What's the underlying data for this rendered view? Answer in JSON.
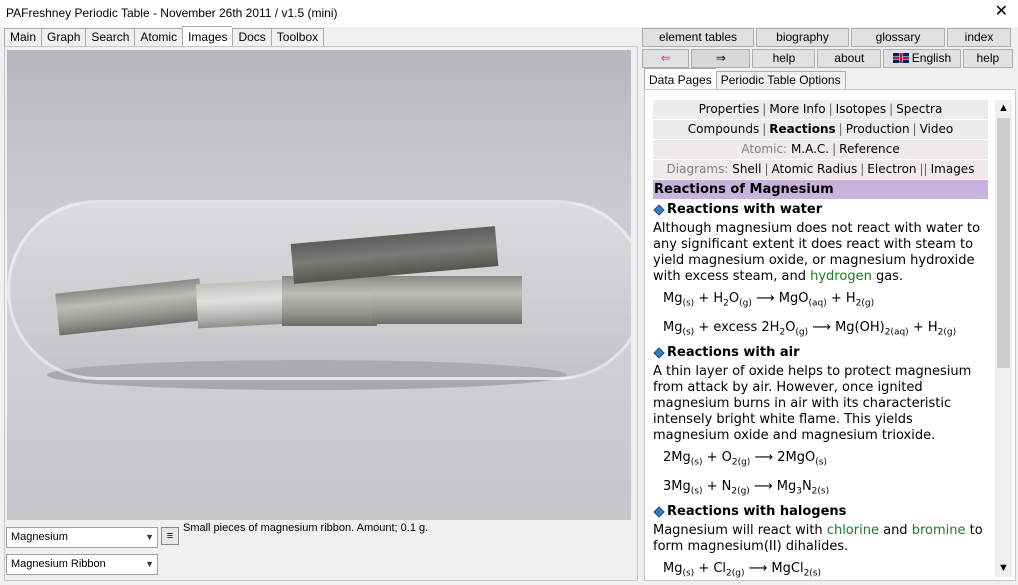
{
  "window": {
    "title": "PAFreshney Periodic Table - November 26th 2011 / v1.5 (mini)",
    "close": "✕"
  },
  "left_tabs": [
    {
      "label": "Main"
    },
    {
      "label": "Graph"
    },
    {
      "label": "Search"
    },
    {
      "label": "Atomic"
    },
    {
      "label": "Images",
      "active": true
    },
    {
      "label": "Docs"
    },
    {
      "label": "Toolbox"
    }
  ],
  "image_panel": {
    "caption": "Small pieces of magnesium ribbon. Amount; 0.1 g.",
    "element_select": "Magnesium",
    "image_select": "Magnesium Ribbon"
  },
  "right_buttons": {
    "row1": [
      "element tables",
      "biography",
      "glossary",
      "index"
    ],
    "row2": {
      "back": "⇐",
      "forward": "⇒",
      "help": "help",
      "about": "about",
      "language": "English",
      "help2": "help"
    }
  },
  "right_tabs": [
    {
      "label": "Data Pages",
      "active": true
    },
    {
      "label": "Periodic Table Options"
    }
  ],
  "data_nav": {
    "row1": [
      "Properties",
      "More Info",
      "Isotopes",
      "Spectra"
    ],
    "row2": [
      "Compounds",
      "Reactions",
      "Production",
      "Video"
    ],
    "row3_label": "Atomic:",
    "row3": [
      "M.A.C.",
      "Reference"
    ],
    "row4_label": "Diagrams:",
    "row4": [
      "Shell",
      "Atomic Radius",
      "Electron",
      "Images"
    ]
  },
  "content": {
    "heading": "Reactions of Magnesium",
    "sections": [
      {
        "title": "Reactions with water",
        "text_before": "Although magnesium does not react with water to any significant extent it does react with steam to yield magnesium oxide, or magnesium hydroxide with excess steam, and ",
        "link": "hydrogen",
        "text_after": " gas."
      },
      {
        "title": "Reactions with air",
        "text": "A thin layer of oxide helps to protect magnesium from attack by air. However, once ignited magnesium burns in air with its characteristic intensely bright white flame. This yields magnesium oxide and magnesium trioxide."
      },
      {
        "title": "Reactions with halogens",
        "text_before": "Magnesium will react with ",
        "link1": "chlorine",
        "mid": " and ",
        "link2": "bromine",
        "text_after": " to form magnesium(II) dihalides."
      }
    ]
  },
  "colors": {
    "heading_bg": "#c9b3dc",
    "link_green": "#207a20",
    "nav_bg": "#ececec",
    "nav_pink": "#f2e9e9"
  },
  "icons": {
    "back": "arrow-left-icon",
    "forward": "arrow-right-icon",
    "flag": "uk-flag-icon",
    "bullet": "cube-bullet-icon"
  }
}
